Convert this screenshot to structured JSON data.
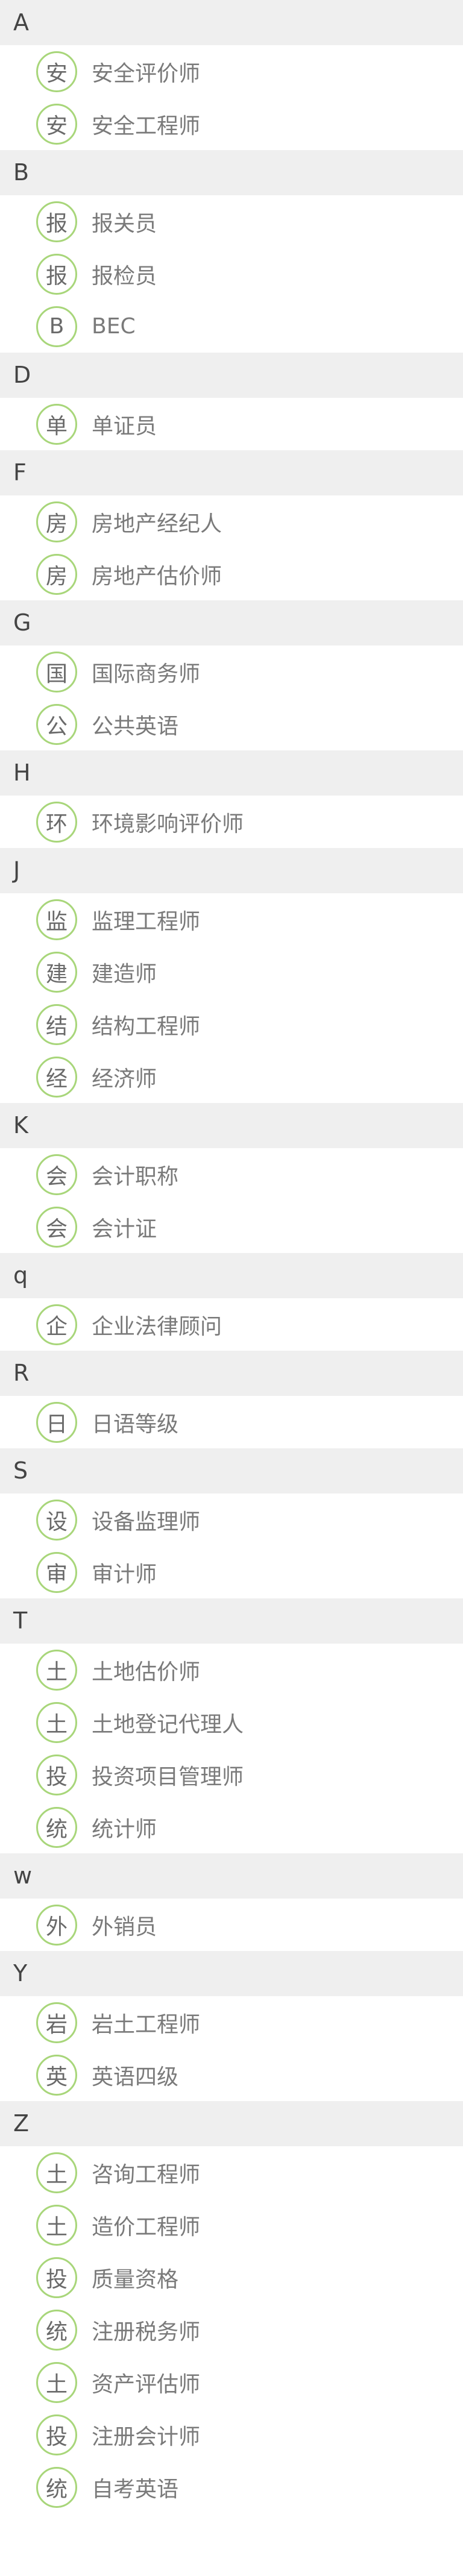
{
  "groups": [
    {
      "letter": "A",
      "items": [
        {
          "badge": "安",
          "label": "安全评价师"
        },
        {
          "badge": "安",
          "label": "安全工程师"
        }
      ]
    },
    {
      "letter": "B",
      "items": [
        {
          "badge": "报",
          "label": "报关员"
        },
        {
          "badge": "报",
          "label": "报检员"
        },
        {
          "badge": "B",
          "label": "BEC"
        }
      ]
    },
    {
      "letter": "D",
      "items": [
        {
          "badge": "单",
          "label": "单证员"
        }
      ]
    },
    {
      "letter": "F",
      "items": [
        {
          "badge": "房",
          "label": "房地产经纪人"
        },
        {
          "badge": "房",
          "label": "房地产估价师"
        }
      ]
    },
    {
      "letter": "G",
      "items": [
        {
          "badge": "国",
          "label": "国际商务师"
        },
        {
          "badge": "公",
          "label": "公共英语"
        }
      ]
    },
    {
      "letter": "H",
      "items": [
        {
          "badge": "环",
          "label": "环境影响评价师"
        }
      ]
    },
    {
      "letter": "J",
      "items": [
        {
          "badge": "监",
          "label": "监理工程师"
        },
        {
          "badge": "建",
          "label": "建造师"
        },
        {
          "badge": "结",
          "label": "结构工程师"
        },
        {
          "badge": "经",
          "label": "经济师"
        }
      ]
    },
    {
      "letter": "K",
      "items": [
        {
          "badge": "会",
          "label": "会计职称"
        },
        {
          "badge": "会",
          "label": "会计证"
        }
      ]
    },
    {
      "letter": "q",
      "items": [
        {
          "badge": "企",
          "label": "企业法律顾问"
        }
      ]
    },
    {
      "letter": "R",
      "items": [
        {
          "badge": "日",
          "label": "日语等级"
        }
      ]
    },
    {
      "letter": "S",
      "items": [
        {
          "badge": "设",
          "label": "设备监理师"
        },
        {
          "badge": "审",
          "label": "审计师"
        }
      ]
    },
    {
      "letter": "T",
      "items": [
        {
          "badge": "土",
          "label": "土地估价师"
        },
        {
          "badge": "土",
          "label": "土地登记代理人"
        },
        {
          "badge": "投",
          "label": "投资项目管理师"
        },
        {
          "badge": "统",
          "label": "统计师"
        }
      ]
    },
    {
      "letter": "w",
      "items": [
        {
          "badge": "外",
          "label": "外销员"
        }
      ]
    },
    {
      "letter": "Y",
      "items": [
        {
          "badge": "岩",
          "label": "岩土工程师"
        },
        {
          "badge": "英",
          "label": "英语四级"
        }
      ]
    },
    {
      "letter": "Z",
      "items": [
        {
          "badge": "土",
          "label": "咨询工程师"
        },
        {
          "badge": "土",
          "label": "造价工程师"
        },
        {
          "badge": "投",
          "label": "质量资格"
        },
        {
          "badge": "统",
          "label": "注册税务师"
        },
        {
          "badge": "土",
          "label": "资产评估师"
        },
        {
          "badge": "投",
          "label": "注册会计师"
        },
        {
          "badge": "统",
          "label": "自考英语"
        }
      ]
    }
  ]
}
